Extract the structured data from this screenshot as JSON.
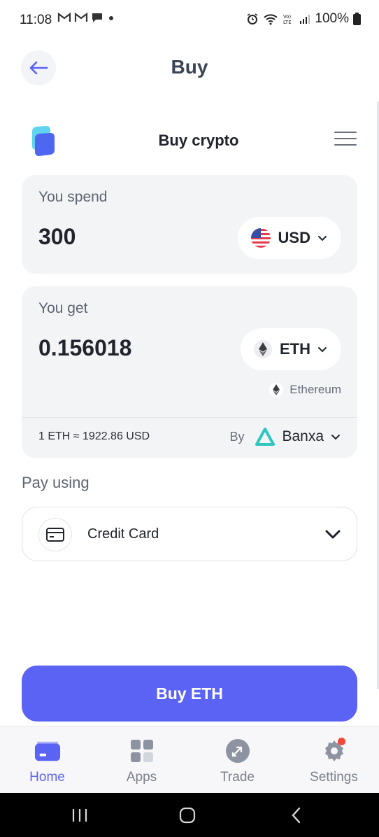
{
  "status_bar": {
    "time": "11:08",
    "notif_icons": [
      "gmail-icon",
      "gmail-icon",
      "chat-icon",
      "dot-icon"
    ],
    "battery": "100%"
  },
  "header": {
    "title": "Buy"
  },
  "widget": {
    "title": "Buy crypto"
  },
  "spend": {
    "label": "You spend",
    "amount": "300",
    "currency": "USD"
  },
  "get": {
    "label": "You get",
    "amount": "0.156018",
    "currency": "ETH",
    "network": "Ethereum",
    "rate": "1 ETH ≈ 1922.86 USD",
    "provider_prefix": "By",
    "provider": "Banxa"
  },
  "pay": {
    "label": "Pay using",
    "method": "Credit Card"
  },
  "cta": {
    "label": "Buy ETH"
  },
  "bottom_nav": [
    {
      "label": "Home",
      "icon": "wallet-icon",
      "active": true
    },
    {
      "label": "Apps",
      "icon": "apps-grid-icon",
      "active": false
    },
    {
      "label": "Trade",
      "icon": "swap-icon",
      "active": false
    },
    {
      "label": "Settings",
      "icon": "gear-icon",
      "active": false
    }
  ],
  "colors": {
    "accent": "#5b63f5",
    "card_bg": "#f3f4f6",
    "notification_dot": "#ef4a3a"
  }
}
